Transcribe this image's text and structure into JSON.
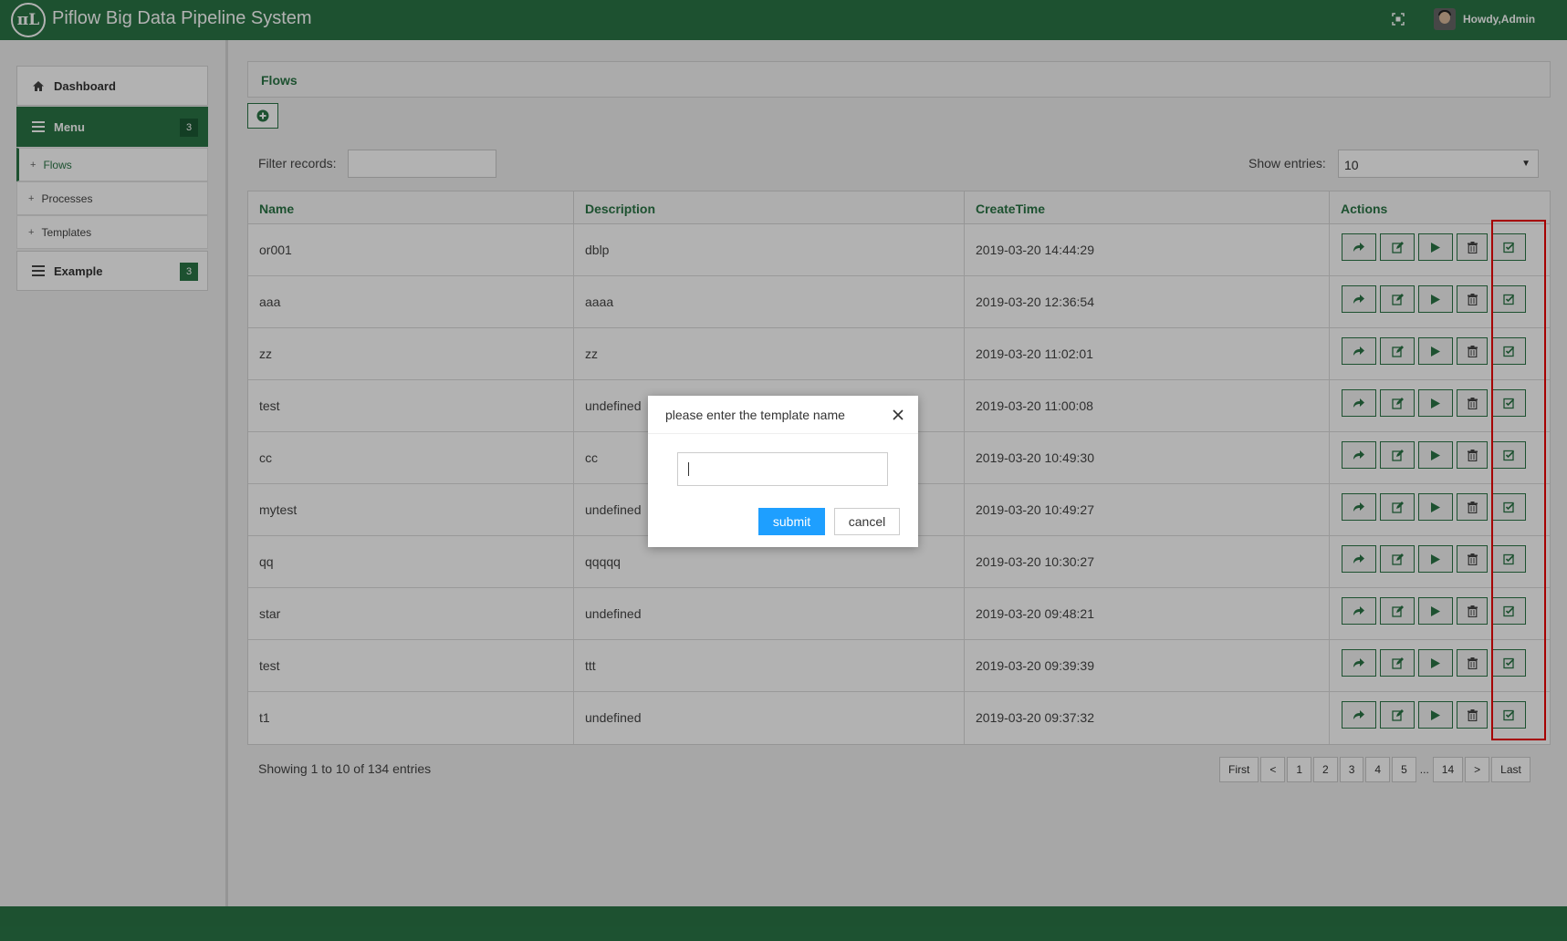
{
  "header": {
    "logo_text": "πL",
    "title": "Piflow Big Data Pipeline System",
    "fullscreen_icon": "fullscreen-icon",
    "user": "Howdy,Admin"
  },
  "sidebar": {
    "dashboard": {
      "label": "Dashboard",
      "icon": "home-icon"
    },
    "menu": {
      "label": "Menu",
      "count": "3",
      "icon": "bars-icon"
    },
    "items": [
      {
        "label": "Flows"
      },
      {
        "label": "Processes"
      },
      {
        "label": "Templates"
      }
    ],
    "example": {
      "label": "Example",
      "count": "3",
      "icon": "bars-icon"
    }
  },
  "main": {
    "panel_title": "Flows",
    "filter_label": "Filter records:",
    "filter_value": "",
    "show_label": "Show entries:",
    "show_value": "10",
    "columns": [
      "Name",
      "Description",
      "CreateTime",
      "Actions"
    ],
    "rows": [
      {
        "name": "or001",
        "description": "dblp",
        "create_time": "2019-03-20 14:44:29"
      },
      {
        "name": "aaa",
        "description": "aaaa",
        "create_time": "2019-03-20 12:36:54"
      },
      {
        "name": "zz",
        "description": "zz",
        "create_time": "2019-03-20 11:02:01"
      },
      {
        "name": "test",
        "description": "undefined",
        "create_time": "2019-03-20 11:00:08"
      },
      {
        "name": "cc",
        "description": "cc",
        "create_time": "2019-03-20 10:49:30"
      },
      {
        "name": "mytest",
        "description": "undefined",
        "create_time": "2019-03-20 10:49:27"
      },
      {
        "name": "qq",
        "description": "qqqqq",
        "create_time": "2019-03-20 10:30:27"
      },
      {
        "name": "star",
        "description": "undefined",
        "create_time": "2019-03-20 09:48:21"
      },
      {
        "name": "test",
        "description": "ttt",
        "create_time": "2019-03-20 09:39:39"
      },
      {
        "name": "t1",
        "description": "undefined",
        "create_time": "2019-03-20 09:37:32"
      }
    ],
    "action_icons": [
      "share-icon",
      "edit-icon",
      "play-icon",
      "trash-icon",
      "check-square-icon"
    ],
    "info": "Showing 1 to 10 of 134 entries",
    "pagination": [
      "First",
      "<",
      "1",
      "2",
      "3",
      "4",
      "5",
      "...",
      "14",
      ">",
      "Last"
    ]
  },
  "modal": {
    "title": "please enter the template name",
    "input_value": "",
    "submit": "submit",
    "cancel": "cancel"
  },
  "colors": {
    "brand": "#2a7546",
    "submit": "#1e9fff",
    "highlight": "#e00000"
  }
}
